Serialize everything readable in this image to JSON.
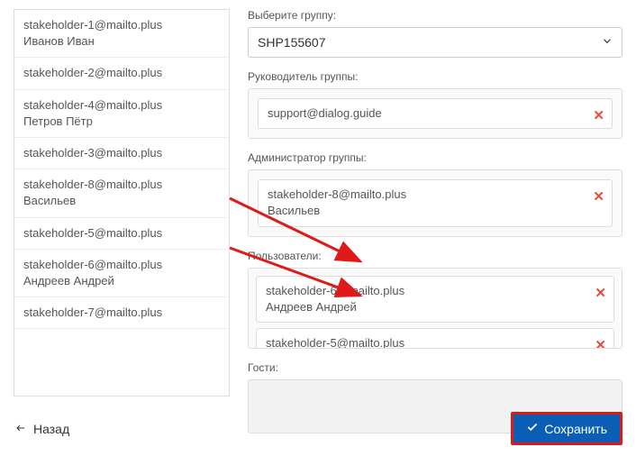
{
  "left_list": [
    {
      "email": "stakeholder-1@mailto.plus",
      "name": "Иванов Иван"
    },
    {
      "email": "stakeholder-2@mailto.plus",
      "name": ""
    },
    {
      "email": "stakeholder-4@mailto.plus",
      "name": "Петров Пётр"
    },
    {
      "email": "stakeholder-3@mailto.plus",
      "name": ""
    },
    {
      "email": "stakeholder-8@mailto.plus",
      "name": "Васильев"
    },
    {
      "email": "stakeholder-5@mailto.plus",
      "name": ""
    },
    {
      "email": "stakeholder-6@mailto.plus",
      "name": "Андреев Андрей"
    },
    {
      "email": "stakeholder-7@mailto.plus",
      "name": ""
    }
  ],
  "labels": {
    "select_group": "Выберите группу:",
    "group_leader": "Руководитель группы:",
    "group_admin": "Администратор группы:",
    "users": "Пользователи:",
    "guests": "Гости:"
  },
  "group_select": {
    "value": "SHP155607"
  },
  "leader": {
    "email": "support@dialog.guide",
    "name": ""
  },
  "admin": {
    "email": "stakeholder-8@mailto.plus",
    "name": "Васильев"
  },
  "users": [
    {
      "email": "stakeholder-6@mailto.plus",
      "name": "Андреев Андрей"
    },
    {
      "email": "stakeholder-5@mailto.plus",
      "name": ""
    }
  ],
  "footer": {
    "back": "Назад",
    "save": "Сохранить"
  }
}
